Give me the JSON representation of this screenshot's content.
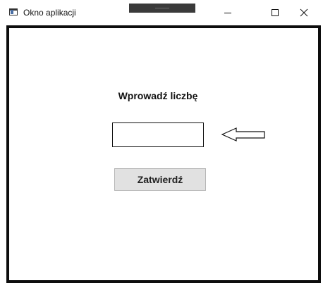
{
  "window": {
    "title": "Okno aplikacji",
    "icon": "app-window-icon",
    "controls": {
      "minimize_icon": "minimize-icon",
      "maximize_icon": "maximize-icon",
      "close_icon": "close-icon"
    }
  },
  "form": {
    "prompt_label": "Wprowadź liczbę",
    "input_value": "",
    "pointer_icon": "left-arrow-icon",
    "submit_label": "Zatwierdź"
  },
  "colors": {
    "frame": "#0d0d0d",
    "button_bg": "#e1e1e1",
    "button_border": "#b5b5b5",
    "titlebar_handle": "#3a3a3a"
  }
}
